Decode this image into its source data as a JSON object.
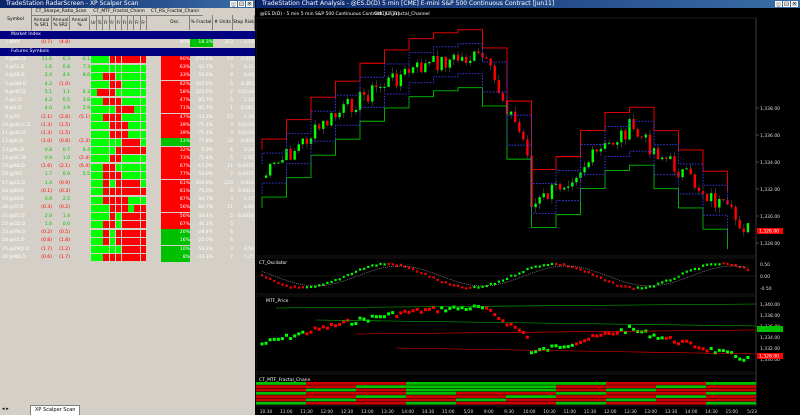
{
  "radar": {
    "title": "TradeStation RadarScreen - XP Scalper Scan",
    "headers": {
      "group_sharpe": "CT_Sharpe_Ratio_Scan",
      "group_mtf": "CT_MTF_Fractal_Chann",
      "group_rs": "CT_RS_Fractal_Chann",
      "symbol": "Symbol",
      "annual_sr1": "Annual % SR1",
      "annual_sr2": "Annual % SR2",
      "annual_pct": "Annual %",
      "tf_cols": [
        "Ur",
        "Tc",
        "Fr",
        "Fr",
        "Fr",
        "Fr",
        "Fr",
        "Fr",
        "Fr"
      ],
      "osc": "Osc.",
      "pct_fractal": "% Fractal",
      "units": "# Units",
      "stop_risk": "Stop Risk"
    },
    "sections": [
      {
        "label": "Market Index",
        "row": 0
      },
      {
        "label": "Futures Symbols",
        "row": 2
      }
    ],
    "rows": [
      {
        "num": "1",
        "sym": "$INX",
        "v1": "(0.7)",
        "v2": "(4.8)",
        "v3": "",
        "c1": "#ff0000",
        "osc": "40%",
        "pct": "18.3%",
        "units": "313",
        "risk": "3.19",
        "pct_color": "#00c000",
        "grid": "",
        "index": true
      },
      {
        "num": "2",
        "sym": "@NG.D",
        "v1": "11.6",
        "v2": "6.3",
        "v3": "6.1",
        "osc": "90%",
        "pct": "256.0%",
        "units": "10",
        "risk": "0.010",
        "osc_color": "#ff0000",
        "grid": "GGGRRRRRR"
      },
      {
        "num": "3",
        "sym": "@CL.D",
        "v1": "1.6",
        "v2": "0.8",
        "v3": "7.3",
        "osc": "63%",
        "pct": "41.7%",
        "units": "3",
        "risk": "0.31",
        "osc_color": "#ff0000",
        "grid": "GGGGGGGGG"
      },
      {
        "num": "4",
        "sym": "@SB.D",
        "v1": "2.4",
        "v2": "4.6",
        "v3": "8.6",
        "osc": "33%",
        "pct": "50.6%",
        "units": "8",
        "risk": "0.48",
        "osc_color": "#ff0000",
        "grid": "GGRRGGGGG"
      },
      {
        "num": "5",
        "sym": "@GM.D",
        "v1": "4.2",
        "v2": "(1.0)",
        "v3": "",
        "osc": "82%",
        "pct": "100.0%",
        "units": "5",
        "risk": "0.365",
        "osc_color": "#ff0000",
        "grid": "GGGRRGGGG"
      },
      {
        "num": "6",
        "sym": "@HO.D",
        "v1": "5.1",
        "v2": "1.1",
        "v3": "6.3",
        "osc": "58%",
        "pct": "125.0%",
        "units": "2",
        "risk": "0.0148",
        "osc_color": "#ff0000",
        "grid": "GRRRGGGGG"
      },
      {
        "num": "7",
        "sym": "@C.D",
        "v1": "4.2",
        "v2": "0.5",
        "v3": "3.8",
        "osc": "47%",
        "pct": "85.7%",
        "units": "5",
        "risk": "2.16",
        "osc_color": "#ff0000",
        "grid": "GGRRRGGGG"
      },
      {
        "num": "8",
        "sym": "@S.D",
        "v1": "4.0",
        "v2": "3.9",
        "v3": "2.9",
        "osc": "71%",
        "pct": "91.7%",
        "units": "1",
        "risk": "0.181",
        "osc_color": "#ff0000",
        "grid": "GGGGRRRGG"
      },
      {
        "num": "9",
        "sym": "@YG",
        "v1": "(2.1)",
        "v2": "(2.6)",
        "v3": "(5.1)",
        "osc": "47%",
        "pct": "-33.3%",
        "units": "13",
        "risk": "2.39",
        "osc_color": "#ff0000",
        "grid": "GGRRRGGGG"
      },
      {
        "num": "10",
        "sym": "@HG.C.D",
        "v1": "(1.3)",
        "v2": "(1.5)",
        "v3": "",
        "osc": "39%",
        "pct": "-71.4%",
        "units": "3",
        "risk": "0.0129",
        "osc_color": "#ff0000",
        "grid": "GGGRRRGGG"
      },
      {
        "num": "11",
        "sym": "@HG.D",
        "v1": "(1.3)",
        "v2": "(1.5)",
        "v3": "",
        "osc": "39%",
        "pct": "-71.4%",
        "units": "3",
        "risk": "0.0129",
        "osc_color": "#ff0000",
        "grid": "GGGRRRGGG"
      },
      {
        "num": "12",
        "sym": "@SI.D",
        "v1": "(1.0)",
        "v2": "(0.8)",
        "v3": "(2.3)",
        "osc": "13%",
        "pct": "77.8%",
        "units": "32",
        "risk": "0.032",
        "osc_color": "#00c000",
        "grid": "GGGGGRRRG"
      },
      {
        "num": "13",
        "sym": "@PL.D",
        "v1": "0.8",
        "v2": "0.7",
        "v3": "6.4",
        "osc": "32%",
        "pct": "5.0%",
        "units": "6",
        "risk": "3.24",
        "osc_color": "#ff0000",
        "grid": "GGGGRRRRR"
      },
      {
        "num": "14",
        "sym": "@GC.D",
        "v1": "0.9",
        "v2": "1.0",
        "v3": "(2.4)",
        "osc": "73%",
        "pct": "71.4%",
        "units": "5",
        "risk": "2.01",
        "osc_color": "#ff0000",
        "grid": "GGGRRGGGG"
      },
      {
        "num": "15",
        "sym": "@RB.D",
        "v1": "(1.6)",
        "v2": "(2.1)",
        "v3": "(6.4)",
        "osc": "67%",
        "pct": "-11.0%",
        "units": "11",
        "risk": "0.0015",
        "osc_color": "#ff0000",
        "grid": "GGRRGGGGG"
      },
      {
        "num": "16",
        "sym": "@JY.D",
        "v1": "1.7",
        "v2": "0.9",
        "v3": "5.5",
        "osc": "77%",
        "pct": "50.0%",
        "units": "7",
        "risk": "0.0015",
        "osc_color": "#ff0000",
        "grid": "GGRRRGGGG"
      },
      {
        "num": "17",
        "sym": "@ED.D",
        "v1": "1.4",
        "v2": "(0.9)",
        "v3": "",
        "osc": "61%",
        "pct": "100.0%",
        "units": "229",
        "risk": "0.010",
        "osc_color": "#ff0000",
        "grid": "GGRGRRRRG"
      },
      {
        "num": "18",
        "sym": "@BP.D",
        "v1": "(0.1)",
        "v2": "(0.3)",
        "v3": "",
        "osc": "81%",
        "pct": "75.0%",
        "units": "8",
        "risk": "0.0013",
        "osc_color": "#ff0000",
        "grid": "GGRRRRRRR"
      },
      {
        "num": "19",
        "sym": "@SP.D",
        "v1": "0.9",
        "v2": "2.5",
        "v3": "",
        "osc": "87%",
        "pct": "94.7%",
        "units": "3",
        "risk": "1.27",
        "osc_color": "#ff0000",
        "grid": "GGRRRRGGG"
      },
      {
        "num": "20",
        "sym": "@TF.D",
        "v1": "(0.3)",
        "v2": "(0.2)",
        "v3": "",
        "osc": "56%",
        "pct": "66.7%",
        "units": "11",
        "risk": "0.92",
        "osc_color": "#ff0000",
        "grid": "GGGRRRGRR"
      },
      {
        "num": "21",
        "sym": "@EC.D",
        "v1": "2.0",
        "v2": "1.4",
        "v3": "",
        "osc": "56%",
        "pct": "54.4%",
        "units": "5",
        "risk": "0.0016",
        "osc_color": "#ff0000",
        "grid": "GGGRGRRRR"
      },
      {
        "num": "22",
        "sym": "@CD.D",
        "v1": "1.6",
        "v2": "0.6",
        "v3": "",
        "osc": "67%",
        "pct": "46.2%",
        "units": "5",
        "risk": "",
        "osc_color": "#ff0000",
        "grid": "GGRRGRRRR"
      },
      {
        "num": "23",
        "sym": "@YM.D",
        "v1": "(0.2)",
        "v2": "(0.5)",
        "v3": "",
        "osc": "20%",
        "pct": "-29.4%",
        "units": "6",
        "risk": "",
        "osc_color": "#00c000",
        "grid": "GGRGRRRRR"
      },
      {
        "num": "24",
        "sym": "@ES.D",
        "v1": "(0.8)",
        "v2": "(1.8)",
        "v3": "",
        "osc": "16%",
        "pct": "-25.0%",
        "units": "6",
        "risk": "",
        "osc_color": "#00c000",
        "grid": "GGRGRRRRR"
      },
      {
        "num": "25",
        "sym": "@EMD.D",
        "v1": "(1.7)",
        "v2": "(1.2)",
        "v3": "",
        "osc": "10%",
        "pct": "-56.2%",
        "units": "3",
        "risk": "3.56",
        "osc_color": "#00c000",
        "grid": "GGGGGRRRR"
      },
      {
        "num": "26",
        "sym": "@NQ.D",
        "v1": "(0.6)",
        "v2": "(1.7)",
        "v3": "",
        "osc": "8%",
        "pct": "-33.3%",
        "units": "7",
        "risk": "7.25",
        "osc_color": "#00c000",
        "grid": "GGRRRRRRR"
      }
    ],
    "tab": "XP Scalper Scan",
    "colors": {
      "red": "#ff0000",
      "green": "#00ff00",
      "darkgreen": "#00c000",
      "blue": "#000080"
    }
  },
  "chart": {
    "title": "TradeStation Chart Analysis - @ES.D(D) 5 min [CME] E-mini S&P 500 Continuous Contract [Jun11]",
    "legend_main": "@ES.D(D) - 5 min  5 min S&P 500 Continuous Contract [Jun11]",
    "legend_main_ind": "CMC  CT_Fractal_Channel",
    "pane_osc": "CT_Oscilator",
    "pane_mtf": "MTF_Price",
    "pane_fractal": "CT_MTF_Fractal_Chann",
    "price_labels": [
      "1,338.00",
      "1,336.00",
      "1,334.00",
      "1,332.00",
      "1,330.00",
      "1,328.00"
    ],
    "last_price": "1,328.00",
    "osc_labels": [
      "0.50",
      "0.00",
      "-0.50"
    ],
    "mtf_labels": [
      "1,340.00",
      "1,338.00",
      "1,336.00",
      "1,334.00",
      "1,332.00",
      "1,330.00"
    ],
    "mtf_last": "1,328.00",
    "time_labels": [
      "10:30",
      "11:00",
      "11:30",
      "12:00",
      "12:30",
      "13:00",
      "13:30",
      "14:00",
      "14:30",
      "15:00",
      "5/20",
      "9:00",
      "9:30",
      "10:00",
      "10:30",
      "11:00",
      "11:30",
      "12:00",
      "12:30",
      "13:00",
      "13:30",
      "14:00",
      "14:30",
      "15:00",
      "5/23"
    ]
  }
}
